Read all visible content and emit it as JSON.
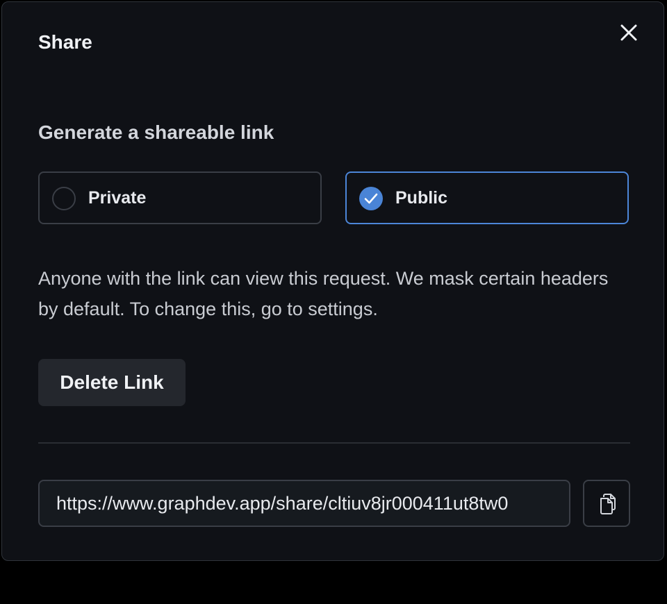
{
  "dialog": {
    "title": "Share",
    "close_icon": "close-icon"
  },
  "share": {
    "section_title": "Generate a shareable link",
    "options": [
      {
        "label": "Private",
        "selected": false
      },
      {
        "label": "Public",
        "selected": true
      }
    ],
    "description": "Anyone with the link can view this request. We mask certain headers by default. To change this, go to settings.",
    "delete_label": "Delete Link",
    "link_value": "https://www.graphdev.app/share/cltiuv8jr000411ut8tw0",
    "copy_icon": "copy-icon"
  },
  "colors": {
    "accent": "#4a84d6",
    "background": "#0f1116"
  }
}
